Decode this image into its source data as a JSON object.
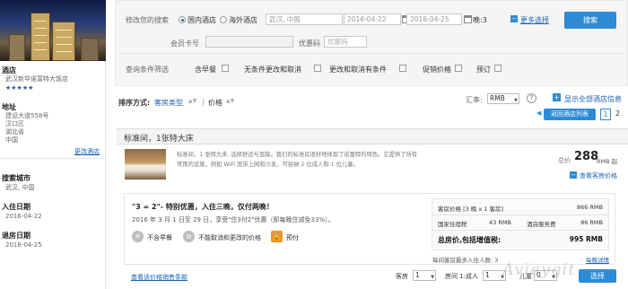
{
  "sidebar": {
    "section_hotel": "酒店",
    "hotel_name": "武汉新华诺富特大饭店",
    "stars": "★★★★★",
    "section_address": "地址",
    "address_lines": [
      "建设大道558号",
      "汉口区",
      "湖北省",
      "中国"
    ],
    "change_hotel": "更改酒店",
    "section_city": "搜索城市",
    "city_value": "武汉, 中国",
    "section_checkin": "入住日期",
    "checkin_value": "2016-04-22",
    "section_checkout": "退房日期",
    "checkout_value": "2016-04-25"
  },
  "search": {
    "change_label": "修改您的搜索",
    "domestic": "国内酒店",
    "overseas": "海外酒店",
    "city": "武汉, 中国",
    "checkin": "2016-04-22",
    "checkout": "2016-04-25",
    "nights": "晚:3",
    "more_options": "更多选择",
    "search_button": "搜索",
    "member_label": "会员卡号",
    "member_value": "",
    "promo_label": "优惠码",
    "promo_placeholder": "优惠码",
    "filter_label": "查询条件筛选",
    "filters": [
      "含早餐",
      "无条件更改和取消",
      "更改和取消有条件",
      "促销价格",
      "预订"
    ]
  },
  "sortbar": {
    "sort_label": "排序方式:",
    "room_type": "客房类型",
    "price": "价格",
    "rate_label": "汇率:",
    "currency": "RMB",
    "help": "?",
    "show_all": "显示全部酒店信息",
    "back_button": "返回酒店列表",
    "pages": [
      "1",
      "2"
    ]
  },
  "room": {
    "title": "标准间，1张特大床",
    "desc_line1": "标准间，1 张特大床. 选择舒适与宽敞。我们的标准房很好地体现了诺富特的特色。它提供了所有",
    "desc_line2": "常用的设施，例如 WiFi 宽带上网和沙发。可容纳 2 位成人和 1 位儿童。",
    "from_label": "总价",
    "price": "288",
    "price_suffix": "RMB 起",
    "view_rooms": "查看客房价格"
  },
  "deal": {
    "title": "\"3 = 2\"- 特别优惠，入住三晚，仅付两晚！",
    "desc": "2016 年 3 月 1 日至 29 日，享受\"住3付2\"优惠（即每晚住减免33%）。",
    "tag_breakfast": "不含早餐",
    "tag_nochange": "不能取消和更改的价格",
    "tag_prepay": "预付",
    "price_rows": [
      {
        "label": "客房价格 [3 晚 x 1 客房]",
        "value": "866 RMB"
      },
      {
        "label": "国家住宿税",
        "value": "43 RMB",
        "label2": "酒店服务费",
        "value2": "86 RMB"
      }
    ],
    "total_label": "总房价,包括增值税:",
    "total_value": "995 RMB",
    "max_adults": "每间客房最多入住人数: 3",
    "night_details": "每晚详情",
    "view_more": "查看该价格销售条款",
    "rooms_label": "客房",
    "rooms_value": "1",
    "room1_label": "房间 1:成人",
    "adults_value": "1",
    "children_label": "儿童",
    "children_value": "0",
    "select_button": "选择"
  },
  "watermark": "Aviaygit"
}
